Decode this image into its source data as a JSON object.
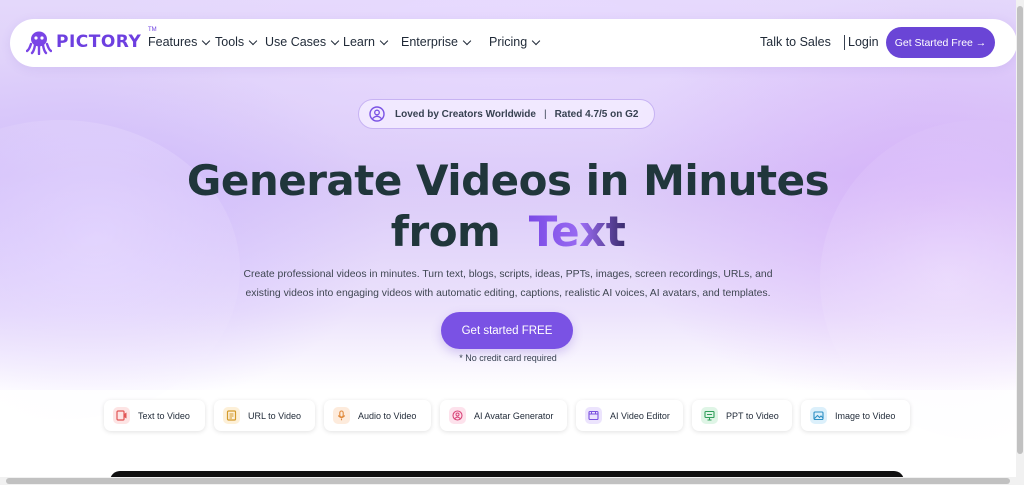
{
  "brand": {
    "name": "PICTORY",
    "tm": "TM",
    "color": "#6d3fe0"
  },
  "nav": {
    "items": [
      {
        "label": "Features"
      },
      {
        "label": "Tools"
      },
      {
        "label": "Use Cases"
      },
      {
        "label": "Learn"
      },
      {
        "label": "Enterprise"
      },
      {
        "label": "Pricing"
      }
    ],
    "talk_to_sales": "Talk to Sales",
    "login": "Login",
    "get_started": "Get Started Free →"
  },
  "badge": {
    "icon": "user-circle-icon",
    "loved": "Loved by Creators Worldwide",
    "sep": "|",
    "rating": "Rated 4.7/5 on G2"
  },
  "hero": {
    "line1": "Generate Videos in Minutes",
    "line2_prefix": "from",
    "line2_accent": "Text",
    "sub1": "Create professional videos in minutes. Turn text, blogs, scripts, ideas, PPTs, images, screen recordings, URLs, and",
    "sub2": "existing videos into engaging videos with automatic editing, captions, realistic AI voices, AI avatars, and templates.",
    "cta": "Get started FREE",
    "note": "* No credit card required"
  },
  "chips": [
    {
      "label": "Text to Video",
      "icon": "text-video-icon",
      "bg": "#fde4e4",
      "fg": "#e25555"
    },
    {
      "label": "URL to Video",
      "icon": "url-doc-icon",
      "bg": "#fdf0d8",
      "fg": "#d49a2a"
    },
    {
      "label": "Audio to Video",
      "icon": "microphone-icon",
      "bg": "#fdebdc",
      "fg": "#e08a3c"
    },
    {
      "label": "AI Avatar Generator",
      "icon": "avatar-icon",
      "bg": "#fde2ec",
      "fg": "#d9467a"
    },
    {
      "label": "AI Video Editor",
      "icon": "video-editor-icon",
      "bg": "#ece4fd",
      "fg": "#7b52e0"
    },
    {
      "label": "PPT to Video",
      "icon": "presentation-icon",
      "bg": "#dff5e6",
      "fg": "#2f9e5a"
    },
    {
      "label": "Image to Video",
      "icon": "image-icon",
      "bg": "#dcf0fb",
      "fg": "#2b8fc4"
    }
  ],
  "colors": {
    "primary": "#6a45d6",
    "cta": "#7a52e4",
    "heading": "#20363b"
  }
}
